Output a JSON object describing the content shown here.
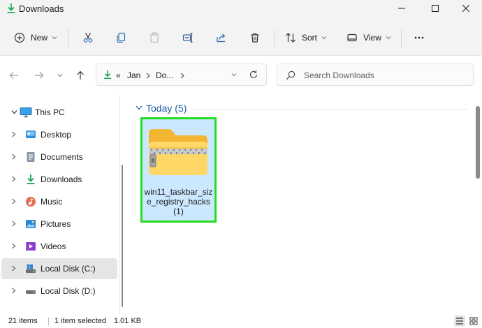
{
  "window": {
    "title": "Downloads",
    "icons": {
      "minimize": "minimize-icon",
      "maximize": "maximize-icon",
      "close": "close-icon"
    }
  },
  "toolbar": {
    "new_label": "New",
    "sort_label": "Sort",
    "view_label": "View",
    "icons": [
      "new-plus-icon",
      "cut-icon",
      "copy-icon",
      "paste-icon",
      "rename-icon",
      "share-icon",
      "delete-icon",
      "sort-icon",
      "view-icon",
      "more-options-icon"
    ]
  },
  "address": {
    "overflow": "«",
    "crumbs": [
      "Jan",
      "Do..."
    ],
    "search_placeholder": "Search Downloads"
  },
  "sidebar": {
    "items": [
      {
        "label": "This PC",
        "icon": "this-pc-icon",
        "expanded": true
      },
      {
        "label": "Desktop",
        "icon": "desktop-folder-icon"
      },
      {
        "label": "Documents",
        "icon": "documents-folder-icon"
      },
      {
        "label": "Downloads",
        "icon": "downloads-folder-icon"
      },
      {
        "label": "Music",
        "icon": "music-folder-icon"
      },
      {
        "label": "Pictures",
        "icon": "pictures-folder-icon"
      },
      {
        "label": "Videos",
        "icon": "videos-folder-icon"
      },
      {
        "label": "Local Disk (C:)",
        "icon": "local-disk-c-icon",
        "selected": true
      },
      {
        "label": "Local Disk (D:)",
        "icon": "local-disk-d-icon"
      }
    ]
  },
  "content": {
    "group_header": "Today (5)",
    "file": {
      "name": "win11_taskbar_size_registry_hacks (1)",
      "icon": "zip-folder-icon"
    }
  },
  "statusbar": {
    "item_count": "21 items",
    "selection": "1 item selected",
    "size": "1.01 KB"
  },
  "colors": {
    "accent_blue": "#1f5aa6",
    "selection_fill": "#cce8ff",
    "highlight_border": "#22dd22",
    "download_green": "#16a34a"
  }
}
